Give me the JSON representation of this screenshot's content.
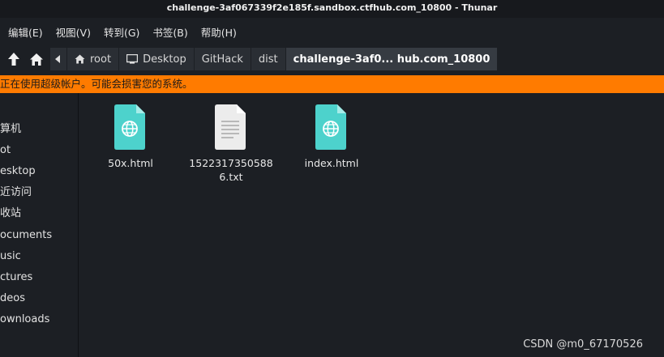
{
  "window": {
    "title": "challenge-3af067339f2e185f.sandbox.ctfhub.com_10800 - Thunar"
  },
  "menubar": {
    "items": [
      "编辑(E)",
      "视图(V)",
      "转到(G)",
      "书签(B)",
      "帮助(H)"
    ]
  },
  "toolbar": {
    "icons": [
      "up-arrow-icon",
      "home-icon",
      "chevron-left-icon"
    ],
    "breadcrumbs": [
      "root",
      "Desktop",
      "GitHack",
      "dist",
      "challenge-3af0...  hub.com_10800"
    ]
  },
  "warning": {
    "text": "正在使用超级帐户。可能会损害您的系统。",
    "color": "#ff7b00"
  },
  "sidebar": {
    "items": [
      "算机",
      "ot",
      "esktop",
      "近访问",
      "收站",
      "ocuments",
      "usic",
      "ctures",
      "deos",
      "ownloads"
    ]
  },
  "files": [
    {
      "name": "50x.html",
      "icon": "html-file-icon"
    },
    {
      "name": "15223173505886.txt",
      "icon": "text-file-icon"
    },
    {
      "name": "index.html",
      "icon": "html-file-icon"
    }
  ],
  "watermark": "CSDN @m0_67170526"
}
